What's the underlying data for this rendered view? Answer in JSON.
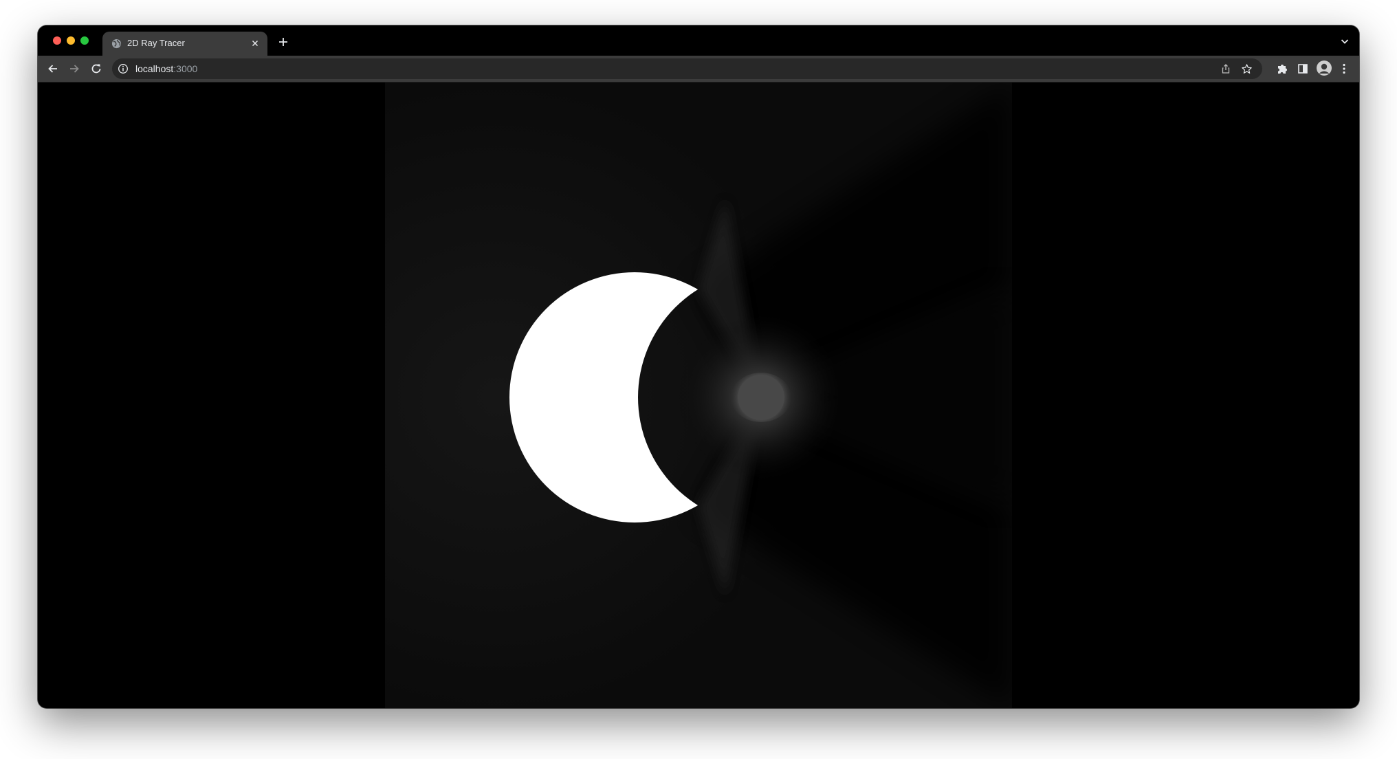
{
  "window": {
    "traffic_lights": [
      "close",
      "minimize",
      "maximize"
    ]
  },
  "tabs": [
    {
      "title": "2D Ray Tracer",
      "icon": "globe-icon",
      "active": true
    }
  ],
  "toolbar": {
    "url_host": "localhost",
    "url_port": ":3000",
    "icons": [
      "back-arrow-icon",
      "forward-arrow-icon",
      "reload-icon",
      "info-icon",
      "share-icon",
      "bookmark-star-icon",
      "extensions-puzzle-icon",
      "side-panel-icon",
      "profile-avatar-icon",
      "menu-kebab-icon"
    ]
  },
  "canvas": {
    "background": "#000000",
    "light_color": "#ffffff",
    "render": "2D ray-traced scene: white crescent light source with a small grey occluding disk casting shadows"
  }
}
